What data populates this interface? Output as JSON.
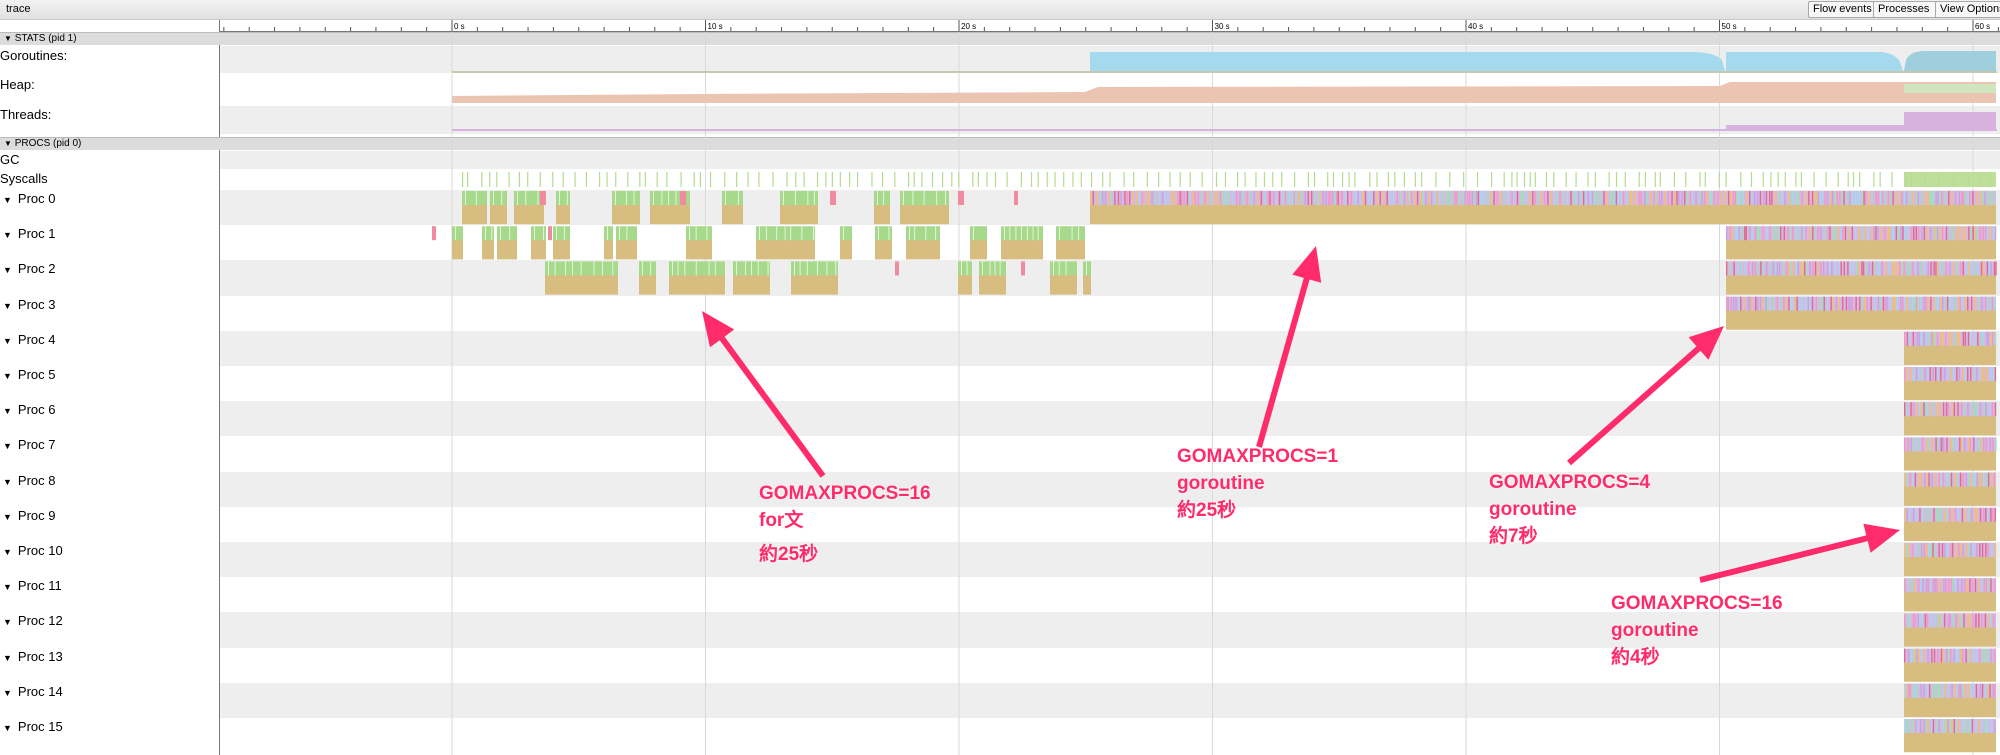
{
  "app": {
    "title": "trace"
  },
  "toolbar": {
    "buttons": [
      "Flow events",
      "Processes",
      "View Options"
    ]
  },
  "timeline": {
    "ticks": [
      "0 s",
      "10 s",
      "20 s",
      "30 s",
      "40 s",
      "50 s",
      "60 s"
    ]
  },
  "stats_section": {
    "header": "STATS (pid 1)",
    "rows": [
      "Goroutines:",
      "Heap:",
      "Threads:"
    ]
  },
  "procs_section": {
    "header": "PROCS (pid 0)",
    "gc_label": "GC",
    "syscalls_label": "Syscalls",
    "procs": [
      "Proc 0",
      "Proc 1",
      "Proc 2",
      "Proc 3",
      "Proc 4",
      "Proc 5",
      "Proc 6",
      "Proc 7",
      "Proc 8",
      "Proc 9",
      "Proc 10",
      "Proc 11",
      "Proc 12",
      "Proc 13",
      "Proc 14",
      "Proc 15"
    ]
  },
  "annotations": [
    {
      "lines": [
        "GOMAXPROCS=16",
        "for文",
        "約25秒"
      ]
    },
    {
      "lines": [
        "GOMAXPROCS=1",
        "goroutine",
        "約25秒"
      ]
    },
    {
      "lines": [
        "GOMAXPROCS=4",
        "goroutine",
        "約7秒"
      ]
    },
    {
      "lines": [
        "GOMAXPROCS=16",
        "goroutine",
        "約4秒"
      ]
    }
  ],
  "colors": {
    "annotation": "#ff2b6a",
    "goroutines": "#a4d9ee",
    "heap": "#ebc4b2",
    "threads": "#d7b2de",
    "proc_base": "#d8bd80",
    "proc_green": "#a6d98a",
    "syscall": "#b7db8e"
  }
}
